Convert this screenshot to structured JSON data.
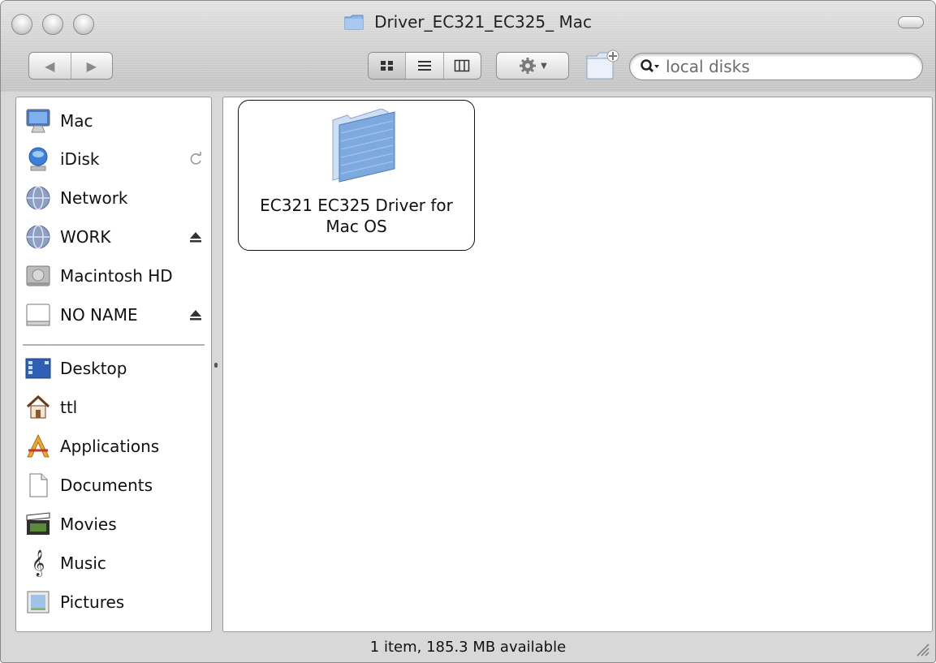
{
  "window": {
    "title": "Driver_EC321_EC325_ Mac"
  },
  "toolbar": {
    "back_icon": "back-arrow",
    "forward_icon": "forward-arrow",
    "views": [
      "icon-view",
      "list-view",
      "column-view"
    ],
    "active_view": "icon-view",
    "action_icon": "gear-icon",
    "new_folder_icon": "new-folder-icon"
  },
  "search": {
    "placeholder": "local disks"
  },
  "sidebar": {
    "devices": [
      {
        "label": "Mac",
        "icon": "computer-icon"
      },
      {
        "label": "iDisk",
        "icon": "idisk-icon",
        "accessory": "sync-icon"
      },
      {
        "label": "Network",
        "icon": "network-globe-icon"
      },
      {
        "label": "WORK",
        "icon": "network-volume-icon",
        "accessory": "eject-icon"
      },
      {
        "label": "Macintosh HD",
        "icon": "hard-drive-icon"
      },
      {
        "label": "NO NAME",
        "icon": "removable-disk-icon",
        "accessory": "eject-icon"
      }
    ],
    "places": [
      {
        "label": "Desktop",
        "icon": "desktop-icon"
      },
      {
        "label": "ttl",
        "icon": "home-icon"
      },
      {
        "label": "Applications",
        "icon": "applications-icon"
      },
      {
        "label": "Documents",
        "icon": "documents-icon"
      },
      {
        "label": "Movies",
        "icon": "movies-icon"
      },
      {
        "label": "Music",
        "icon": "music-icon"
      },
      {
        "label": "Pictures",
        "icon": "pictures-icon"
      }
    ]
  },
  "content": {
    "items": [
      {
        "label": "EC321 EC325 Driver for Mac OS",
        "icon": "folder-icon",
        "selected": true
      }
    ]
  },
  "status": {
    "text": "1 item, 185.3 MB available"
  },
  "colors": {
    "folder_blue": "#7ea9df",
    "selection_border": "#111111",
    "chrome": "#d2d2d2"
  }
}
